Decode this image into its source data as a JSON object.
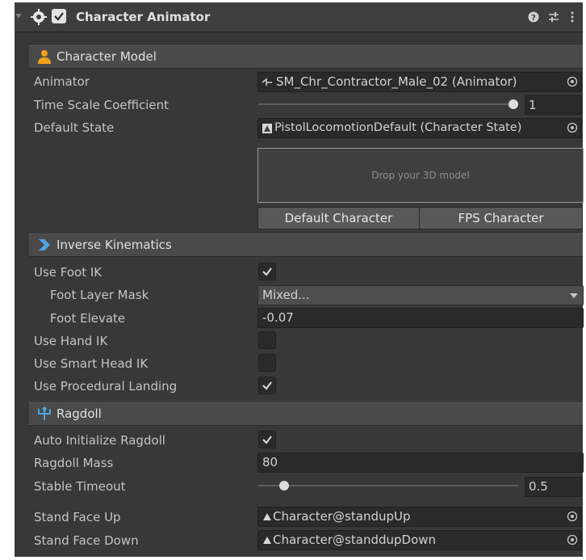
{
  "component": {
    "title": "Character Animator"
  },
  "sections": {
    "model": "Character Model",
    "ik": "Inverse Kinematics",
    "ragdoll": "Ragdoll"
  },
  "fields": {
    "animator": {
      "label": "Animator",
      "value": "SM_Chr_Contractor_Male_02 (Animator)"
    },
    "time_scale": {
      "label": "Time Scale Coefficient",
      "value": "1",
      "slider_fraction": 1.0
    },
    "default_state": {
      "label": "Default State",
      "value": "PistolLocomotionDefault (Character State)"
    },
    "drop_zone": "Drop your 3D model",
    "default_character_button": "Default Character",
    "fps_character_button": "FPS Character",
    "use_foot_ik": {
      "label": "Use Foot IK",
      "checked": true
    },
    "foot_layer_mask": {
      "label": "Foot Layer Mask",
      "value": "Mixed..."
    },
    "foot_elevate": {
      "label": "Foot Elevate",
      "value": "-0.07"
    },
    "use_hand_ik": {
      "label": "Use Hand IK",
      "checked": false
    },
    "use_smart_head_ik": {
      "label": "Use Smart Head IK",
      "checked": false
    },
    "use_procedural_landing": {
      "label": "Use Procedural Landing",
      "checked": true
    },
    "auto_init_ragdoll": {
      "label": "Auto Initialize Ragdoll",
      "checked": true
    },
    "ragdoll_mass": {
      "label": "Ragdoll Mass",
      "value": "80"
    },
    "stable_timeout": {
      "label": "Stable Timeout",
      "value": "0.5",
      "slider_fraction": 0.1
    },
    "stand_face_up": {
      "label": "Stand Face Up",
      "value": "Character@standupUp"
    },
    "stand_face_down": {
      "label": "Stand Face Down",
      "value": "Character@standdupDown"
    }
  },
  "icons": {
    "component": "gear-icon",
    "model": "person-icon",
    "ik": "ik-chevron-icon",
    "ragdoll": "ragdoll-icon",
    "help": "help-icon",
    "presets": "presets-icon",
    "menu": "kebab-menu-icon"
  },
  "colors": {
    "accent_orange": "#f0a21b",
    "accent_blue": "#4fa3e0"
  }
}
